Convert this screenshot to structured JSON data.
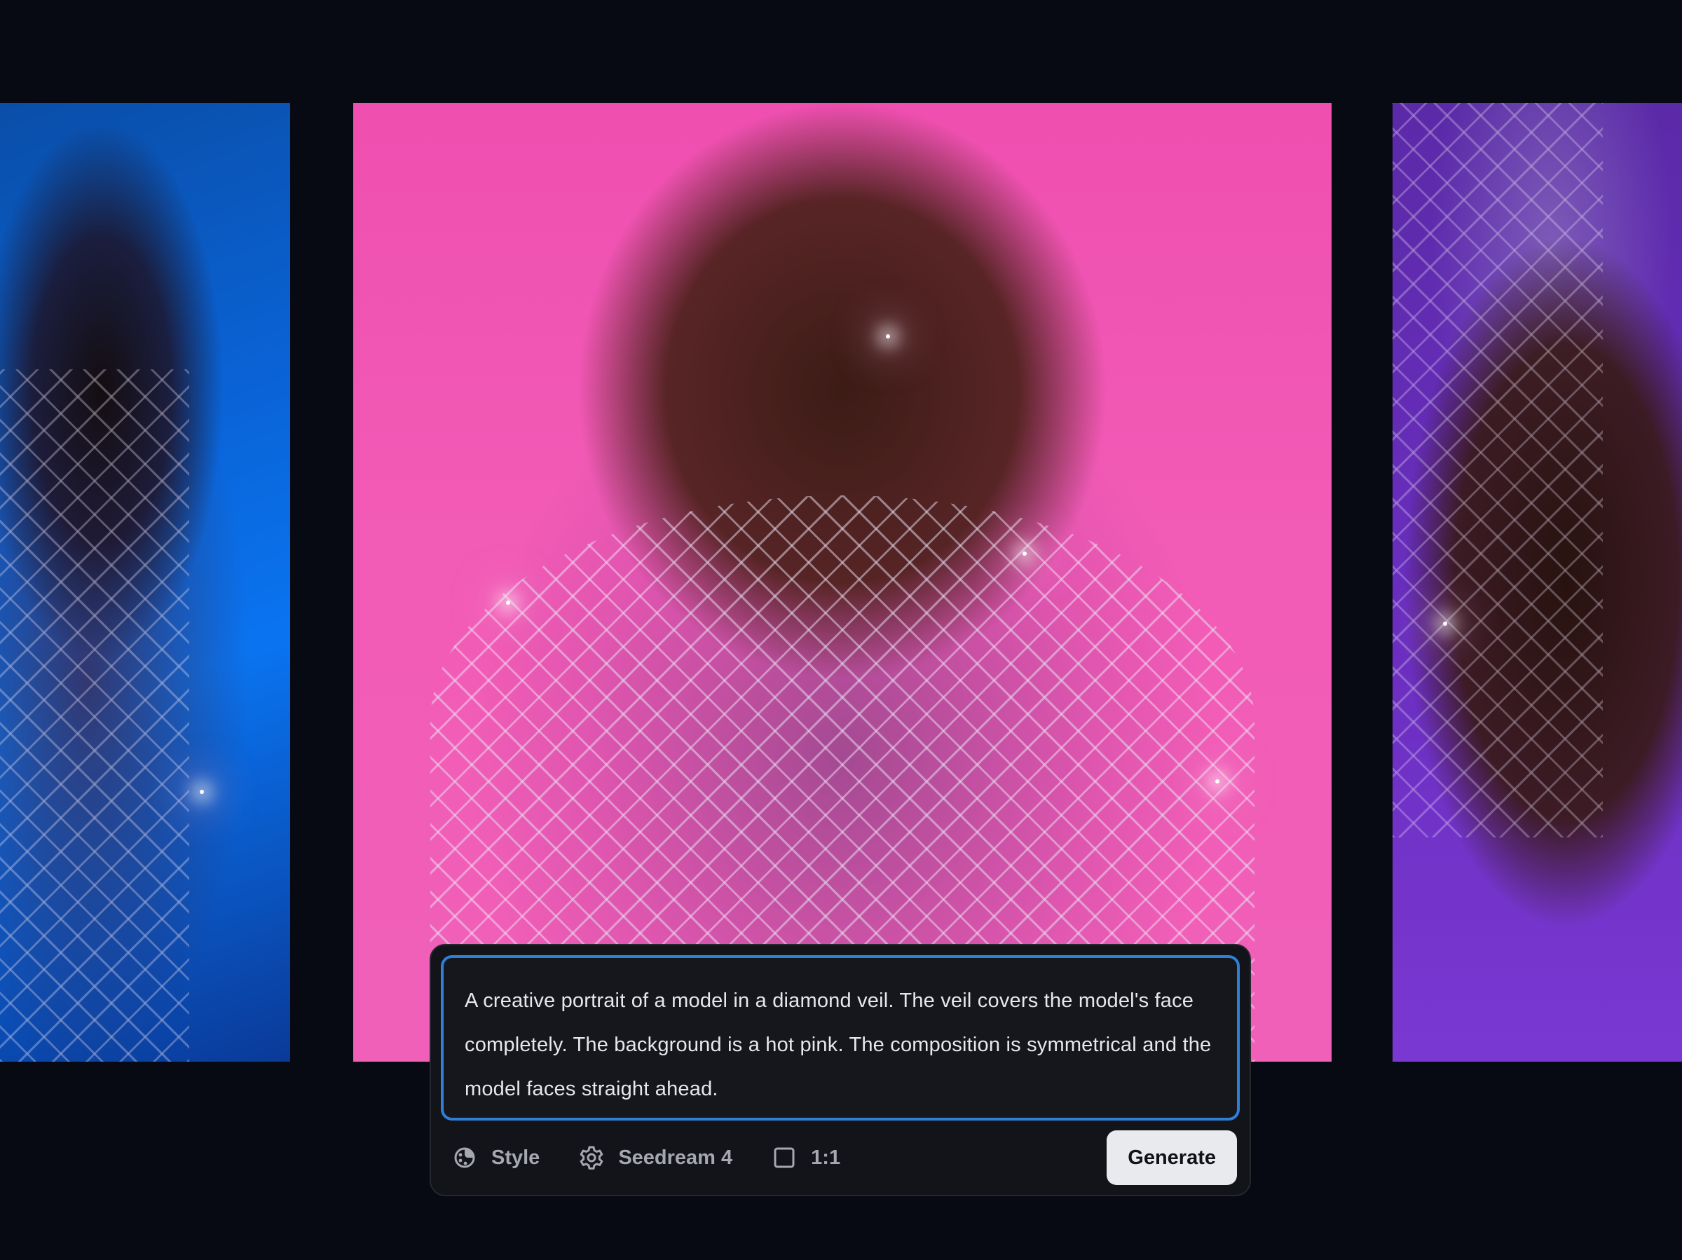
{
  "gallery": {
    "images": [
      {
        "id": "left",
        "description": ""
      },
      {
        "id": "center",
        "description": ""
      },
      {
        "id": "right",
        "description": ""
      }
    ]
  },
  "prompt": {
    "text": "A creative portrait of a model in a diamond veil. The veil covers the model's face completely. The background is a hot pink. The composition is symmetrical and the model faces straight ahead."
  },
  "toolbar": {
    "style_label": "Style",
    "model_label": "Seedream 4",
    "aspect_label": "1:1",
    "generate_label": "Generate"
  },
  "icons": {
    "style": "palette-icon",
    "model": "gear-icon",
    "aspect": "square-icon"
  },
  "colors": {
    "background": "#070a12",
    "dock": "#131419",
    "prompt_border": "#2f7fd8",
    "generate_button": "#e9eaee",
    "tool_text": "#a6a8b1"
  }
}
